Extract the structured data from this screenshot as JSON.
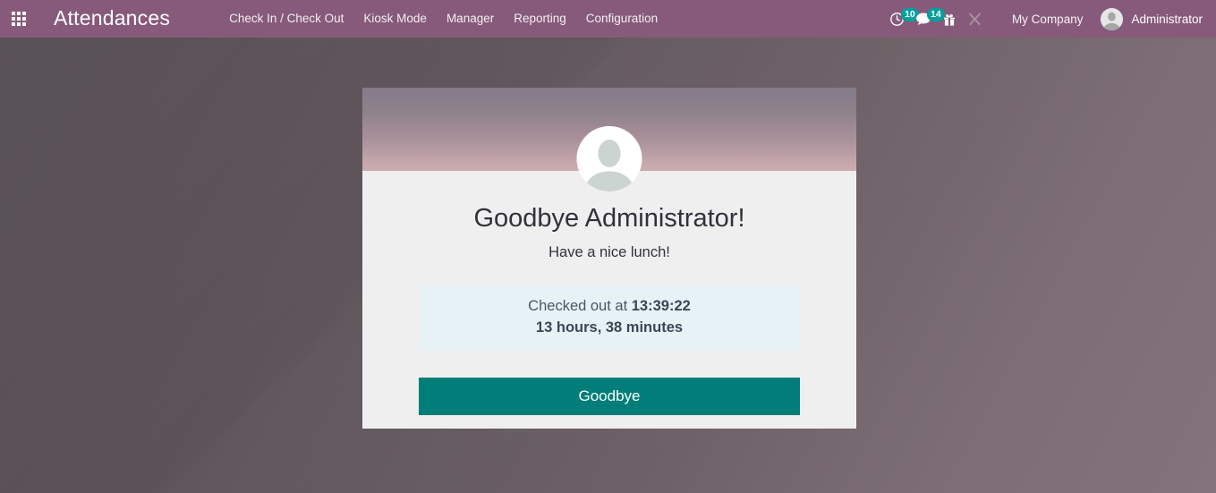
{
  "navbar": {
    "apps_icon": "apps-grid-icon",
    "brand": "Attendances",
    "menu_items": [
      {
        "label": "Check In / Check Out",
        "name": "menu-check-in-check-out"
      },
      {
        "label": "Kiosk Mode",
        "name": "menu-kiosk-mode"
      },
      {
        "label": "Manager",
        "name": "menu-manager"
      },
      {
        "label": "Reporting",
        "name": "menu-reporting"
      },
      {
        "label": "Configuration",
        "name": "menu-configuration"
      }
    ],
    "activities": {
      "icon": "clock-activity-icon",
      "badge": "10"
    },
    "messages": {
      "icon": "chat-bubble-icon",
      "badge": "14"
    },
    "gift": {
      "icon": "gift-box-icon"
    },
    "tools": {
      "icon": "crossed-tools-icon"
    },
    "company": "My Company",
    "user": {
      "name": "Administrator",
      "avatar_icon": "user-avatar-icon"
    }
  },
  "card": {
    "avatar_icon": "employee-placeholder-avatar-icon",
    "greeting": "Goodbye Administrator!",
    "submessage": "Have a nice lunch!",
    "status": {
      "prefix": "Checked out at ",
      "time": "13:39:22",
      "duration": "13 hours, 38 minutes"
    },
    "primary_button": "Goodbye"
  },
  "colors": {
    "navbar": "#875a7b",
    "badge": "#00a09d",
    "primary_button": "#017e79",
    "alert_bg": "#e7f2f7",
    "card_bg": "#efeff0"
  }
}
